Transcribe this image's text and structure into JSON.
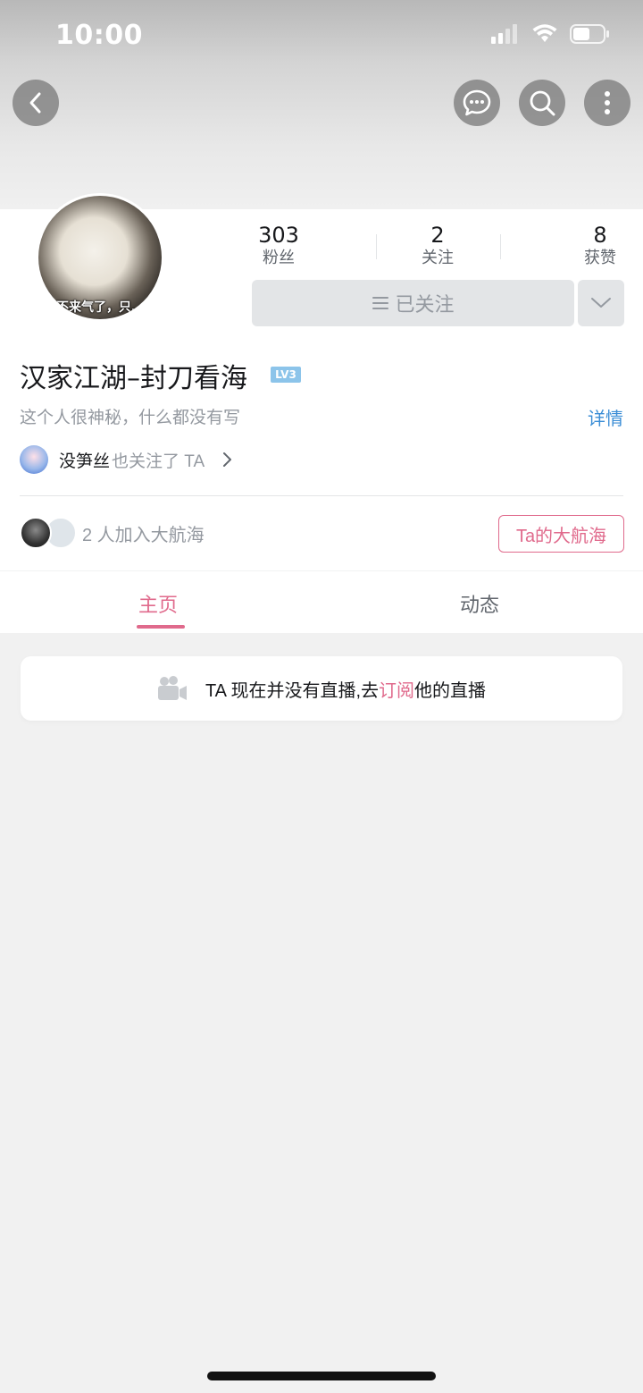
{
  "status_bar": {
    "time": "10:00",
    "icons": [
      "signal-icon",
      "wifi-icon",
      "battery-icon"
    ]
  },
  "nav": {
    "back": "chevron-left-icon",
    "message": "chat-bubble-icon",
    "search": "search-icon",
    "more": "more-vertical-icon"
  },
  "profile": {
    "avatar_caption": "不来气了，只…",
    "username": "汉家江湖–封刀看海",
    "level": "LV3",
    "bio": "这个人很神秘，什么都没有写",
    "details_label": "详情",
    "mutual_follower_name": "没笋丝",
    "mutual_follower_text": "也关注了 TA"
  },
  "stats": [
    {
      "value": "303",
      "label": "粉丝"
    },
    {
      "value": "2",
      "label": "关注"
    },
    {
      "value": "8",
      "label": "获赞"
    }
  ],
  "follow_button": {
    "label": "已关注"
  },
  "guard": {
    "text": "2 人加入大航海",
    "button_label": "Ta的大航海"
  },
  "tabs": [
    {
      "label": "主页",
      "active": true
    },
    {
      "label": "动态",
      "active": false
    }
  ],
  "live_notice": {
    "prefix": "TA 现在并没有直播,去",
    "link": "订阅",
    "suffix": "他的直播"
  },
  "colors": {
    "accent_pink": "#e06a8c",
    "link_blue": "#3c8ed6",
    "level_blue": "#8cc4ea"
  }
}
